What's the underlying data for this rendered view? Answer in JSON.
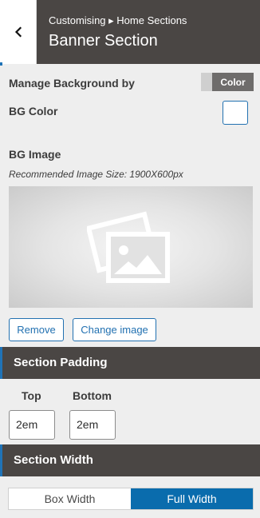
{
  "header": {
    "breadcrumb": "Customising ▸ Home Sections",
    "title": "Banner Section",
    "back_icon": "chevron-left-icon"
  },
  "background": {
    "manage_label": "Manage Background by",
    "toggle_value": "Color",
    "bg_color_label": "BG Color",
    "bg_color_value": "#ffffff"
  },
  "image": {
    "label": "BG Image",
    "hint": "Recommended Image Size: 1900X600px",
    "placeholder_icon": "image-placeholder-icon",
    "remove_label": "Remove",
    "change_label": "Change image"
  },
  "padding": {
    "section_title": "Section Padding",
    "top_label": "Top",
    "bottom_label": "Bottom",
    "top_value": "2em",
    "bottom_value": "2em"
  },
  "width": {
    "section_title": "Section Width",
    "options": [
      "Box Width",
      "Full Width"
    ],
    "selected": "Full Width"
  },
  "colors": {
    "header_bg": "#4a4644",
    "accent": "#2271b1",
    "active_segment": "#0a6cad"
  }
}
